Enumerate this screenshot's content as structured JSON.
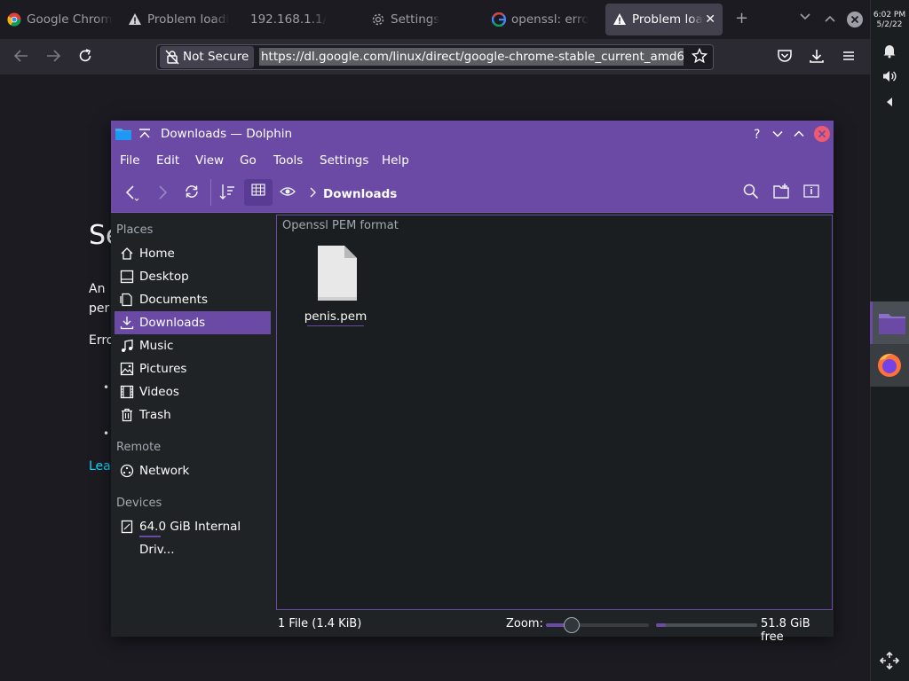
{
  "browser": {
    "tabs": [
      {
        "title": "Google Chrom",
        "icon": "chrome-icon",
        "active": false
      },
      {
        "title": "Problem loadi",
        "icon": "warning-icon",
        "active": false
      },
      {
        "title": "192.168.1.1/",
        "icon": "",
        "active": false
      },
      {
        "title": "Settings",
        "icon": "gear-icon",
        "active": false
      },
      {
        "title": "openssl: erro",
        "icon": "google-icon",
        "active": false
      },
      {
        "title": "Problem loa",
        "icon": "warning-icon",
        "active": true
      }
    ],
    "not_secure_label": "Not Secure",
    "url": "https://dl.google.com/linux/direct/google-chrome-stable_current_amd6"
  },
  "page": {
    "heading_fragment": "Se",
    "line1": "An",
    "line2": "per",
    "line3": "Erro",
    "link": "Lea"
  },
  "panel": {
    "time": "6:02 PM",
    "date": "5/2/22"
  },
  "dolphin": {
    "title": "Downloads — Dolphin",
    "menu": [
      "File",
      "Edit",
      "View",
      "Go",
      "Tools",
      "Settings",
      "Help"
    ],
    "breadcrumb": "Downloads",
    "places_header": "Places",
    "places": [
      {
        "label": "Home",
        "icon": "home-icon"
      },
      {
        "label": "Desktop",
        "icon": "desktop-icon"
      },
      {
        "label": "Documents",
        "icon": "documents-icon"
      },
      {
        "label": "Downloads",
        "icon": "downloads-icon",
        "selected": true
      },
      {
        "label": "Music",
        "icon": "music-icon"
      },
      {
        "label": "Pictures",
        "icon": "pictures-icon"
      },
      {
        "label": "Videos",
        "icon": "videos-icon"
      },
      {
        "label": "Trash",
        "icon": "trash-icon"
      }
    ],
    "remote_header": "Remote",
    "remote": [
      {
        "label": "Network",
        "icon": "network-icon"
      }
    ],
    "devices_header": "Devices",
    "devices": [
      {
        "label": "64.0 GiB Internal Driv...",
        "icon": "drive-icon"
      }
    ],
    "group_header": "Openssl PEM format",
    "file": {
      "name": "penis.pem"
    },
    "status_count": "1 File (1.4 KiB)",
    "zoom_label": "Zoom:",
    "free_space": "51.8 GiB free",
    "zoom_level": 0.25,
    "space_used": 0.1
  },
  "colors": {
    "accent": "#6b4aa6",
    "bg": "#202326"
  }
}
